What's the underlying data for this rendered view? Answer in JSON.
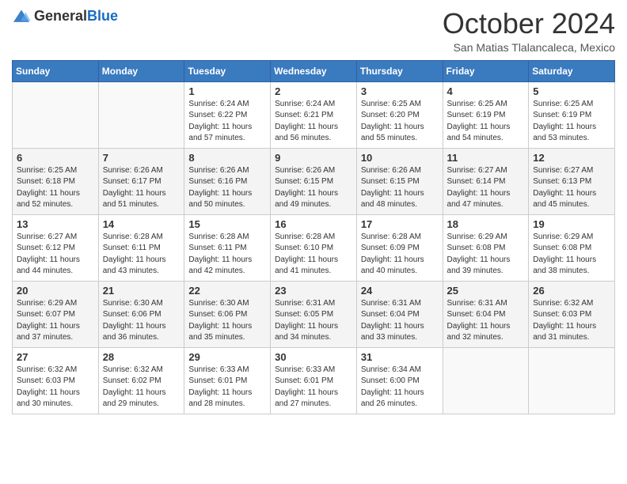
{
  "header": {
    "logo_general": "General",
    "logo_blue": "Blue",
    "month_title": "October 2024",
    "location": "San Matias Tlalancaleca, Mexico"
  },
  "days_of_week": [
    "Sunday",
    "Monday",
    "Tuesday",
    "Wednesday",
    "Thursday",
    "Friday",
    "Saturday"
  ],
  "weeks": [
    [
      {
        "day": "",
        "info": ""
      },
      {
        "day": "",
        "info": ""
      },
      {
        "day": "1",
        "info": "Sunrise: 6:24 AM\nSunset: 6:22 PM\nDaylight: 11 hours and 57 minutes."
      },
      {
        "day": "2",
        "info": "Sunrise: 6:24 AM\nSunset: 6:21 PM\nDaylight: 11 hours and 56 minutes."
      },
      {
        "day": "3",
        "info": "Sunrise: 6:25 AM\nSunset: 6:20 PM\nDaylight: 11 hours and 55 minutes."
      },
      {
        "day": "4",
        "info": "Sunrise: 6:25 AM\nSunset: 6:19 PM\nDaylight: 11 hours and 54 minutes."
      },
      {
        "day": "5",
        "info": "Sunrise: 6:25 AM\nSunset: 6:19 PM\nDaylight: 11 hours and 53 minutes."
      }
    ],
    [
      {
        "day": "6",
        "info": "Sunrise: 6:25 AM\nSunset: 6:18 PM\nDaylight: 11 hours and 52 minutes."
      },
      {
        "day": "7",
        "info": "Sunrise: 6:26 AM\nSunset: 6:17 PM\nDaylight: 11 hours and 51 minutes."
      },
      {
        "day": "8",
        "info": "Sunrise: 6:26 AM\nSunset: 6:16 PM\nDaylight: 11 hours and 50 minutes."
      },
      {
        "day": "9",
        "info": "Sunrise: 6:26 AM\nSunset: 6:15 PM\nDaylight: 11 hours and 49 minutes."
      },
      {
        "day": "10",
        "info": "Sunrise: 6:26 AM\nSunset: 6:15 PM\nDaylight: 11 hours and 48 minutes."
      },
      {
        "day": "11",
        "info": "Sunrise: 6:27 AM\nSunset: 6:14 PM\nDaylight: 11 hours and 47 minutes."
      },
      {
        "day": "12",
        "info": "Sunrise: 6:27 AM\nSunset: 6:13 PM\nDaylight: 11 hours and 45 minutes."
      }
    ],
    [
      {
        "day": "13",
        "info": "Sunrise: 6:27 AM\nSunset: 6:12 PM\nDaylight: 11 hours and 44 minutes."
      },
      {
        "day": "14",
        "info": "Sunrise: 6:28 AM\nSunset: 6:11 PM\nDaylight: 11 hours and 43 minutes."
      },
      {
        "day": "15",
        "info": "Sunrise: 6:28 AM\nSunset: 6:11 PM\nDaylight: 11 hours and 42 minutes."
      },
      {
        "day": "16",
        "info": "Sunrise: 6:28 AM\nSunset: 6:10 PM\nDaylight: 11 hours and 41 minutes."
      },
      {
        "day": "17",
        "info": "Sunrise: 6:28 AM\nSunset: 6:09 PM\nDaylight: 11 hours and 40 minutes."
      },
      {
        "day": "18",
        "info": "Sunrise: 6:29 AM\nSunset: 6:08 PM\nDaylight: 11 hours and 39 minutes."
      },
      {
        "day": "19",
        "info": "Sunrise: 6:29 AM\nSunset: 6:08 PM\nDaylight: 11 hours and 38 minutes."
      }
    ],
    [
      {
        "day": "20",
        "info": "Sunrise: 6:29 AM\nSunset: 6:07 PM\nDaylight: 11 hours and 37 minutes."
      },
      {
        "day": "21",
        "info": "Sunrise: 6:30 AM\nSunset: 6:06 PM\nDaylight: 11 hours and 36 minutes."
      },
      {
        "day": "22",
        "info": "Sunrise: 6:30 AM\nSunset: 6:06 PM\nDaylight: 11 hours and 35 minutes."
      },
      {
        "day": "23",
        "info": "Sunrise: 6:31 AM\nSunset: 6:05 PM\nDaylight: 11 hours and 34 minutes."
      },
      {
        "day": "24",
        "info": "Sunrise: 6:31 AM\nSunset: 6:04 PM\nDaylight: 11 hours and 33 minutes."
      },
      {
        "day": "25",
        "info": "Sunrise: 6:31 AM\nSunset: 6:04 PM\nDaylight: 11 hours and 32 minutes."
      },
      {
        "day": "26",
        "info": "Sunrise: 6:32 AM\nSunset: 6:03 PM\nDaylight: 11 hours and 31 minutes."
      }
    ],
    [
      {
        "day": "27",
        "info": "Sunrise: 6:32 AM\nSunset: 6:03 PM\nDaylight: 11 hours and 30 minutes."
      },
      {
        "day": "28",
        "info": "Sunrise: 6:32 AM\nSunset: 6:02 PM\nDaylight: 11 hours and 29 minutes."
      },
      {
        "day": "29",
        "info": "Sunrise: 6:33 AM\nSunset: 6:01 PM\nDaylight: 11 hours and 28 minutes."
      },
      {
        "day": "30",
        "info": "Sunrise: 6:33 AM\nSunset: 6:01 PM\nDaylight: 11 hours and 27 minutes."
      },
      {
        "day": "31",
        "info": "Sunrise: 6:34 AM\nSunset: 6:00 PM\nDaylight: 11 hours and 26 minutes."
      },
      {
        "day": "",
        "info": ""
      },
      {
        "day": "",
        "info": ""
      }
    ]
  ]
}
